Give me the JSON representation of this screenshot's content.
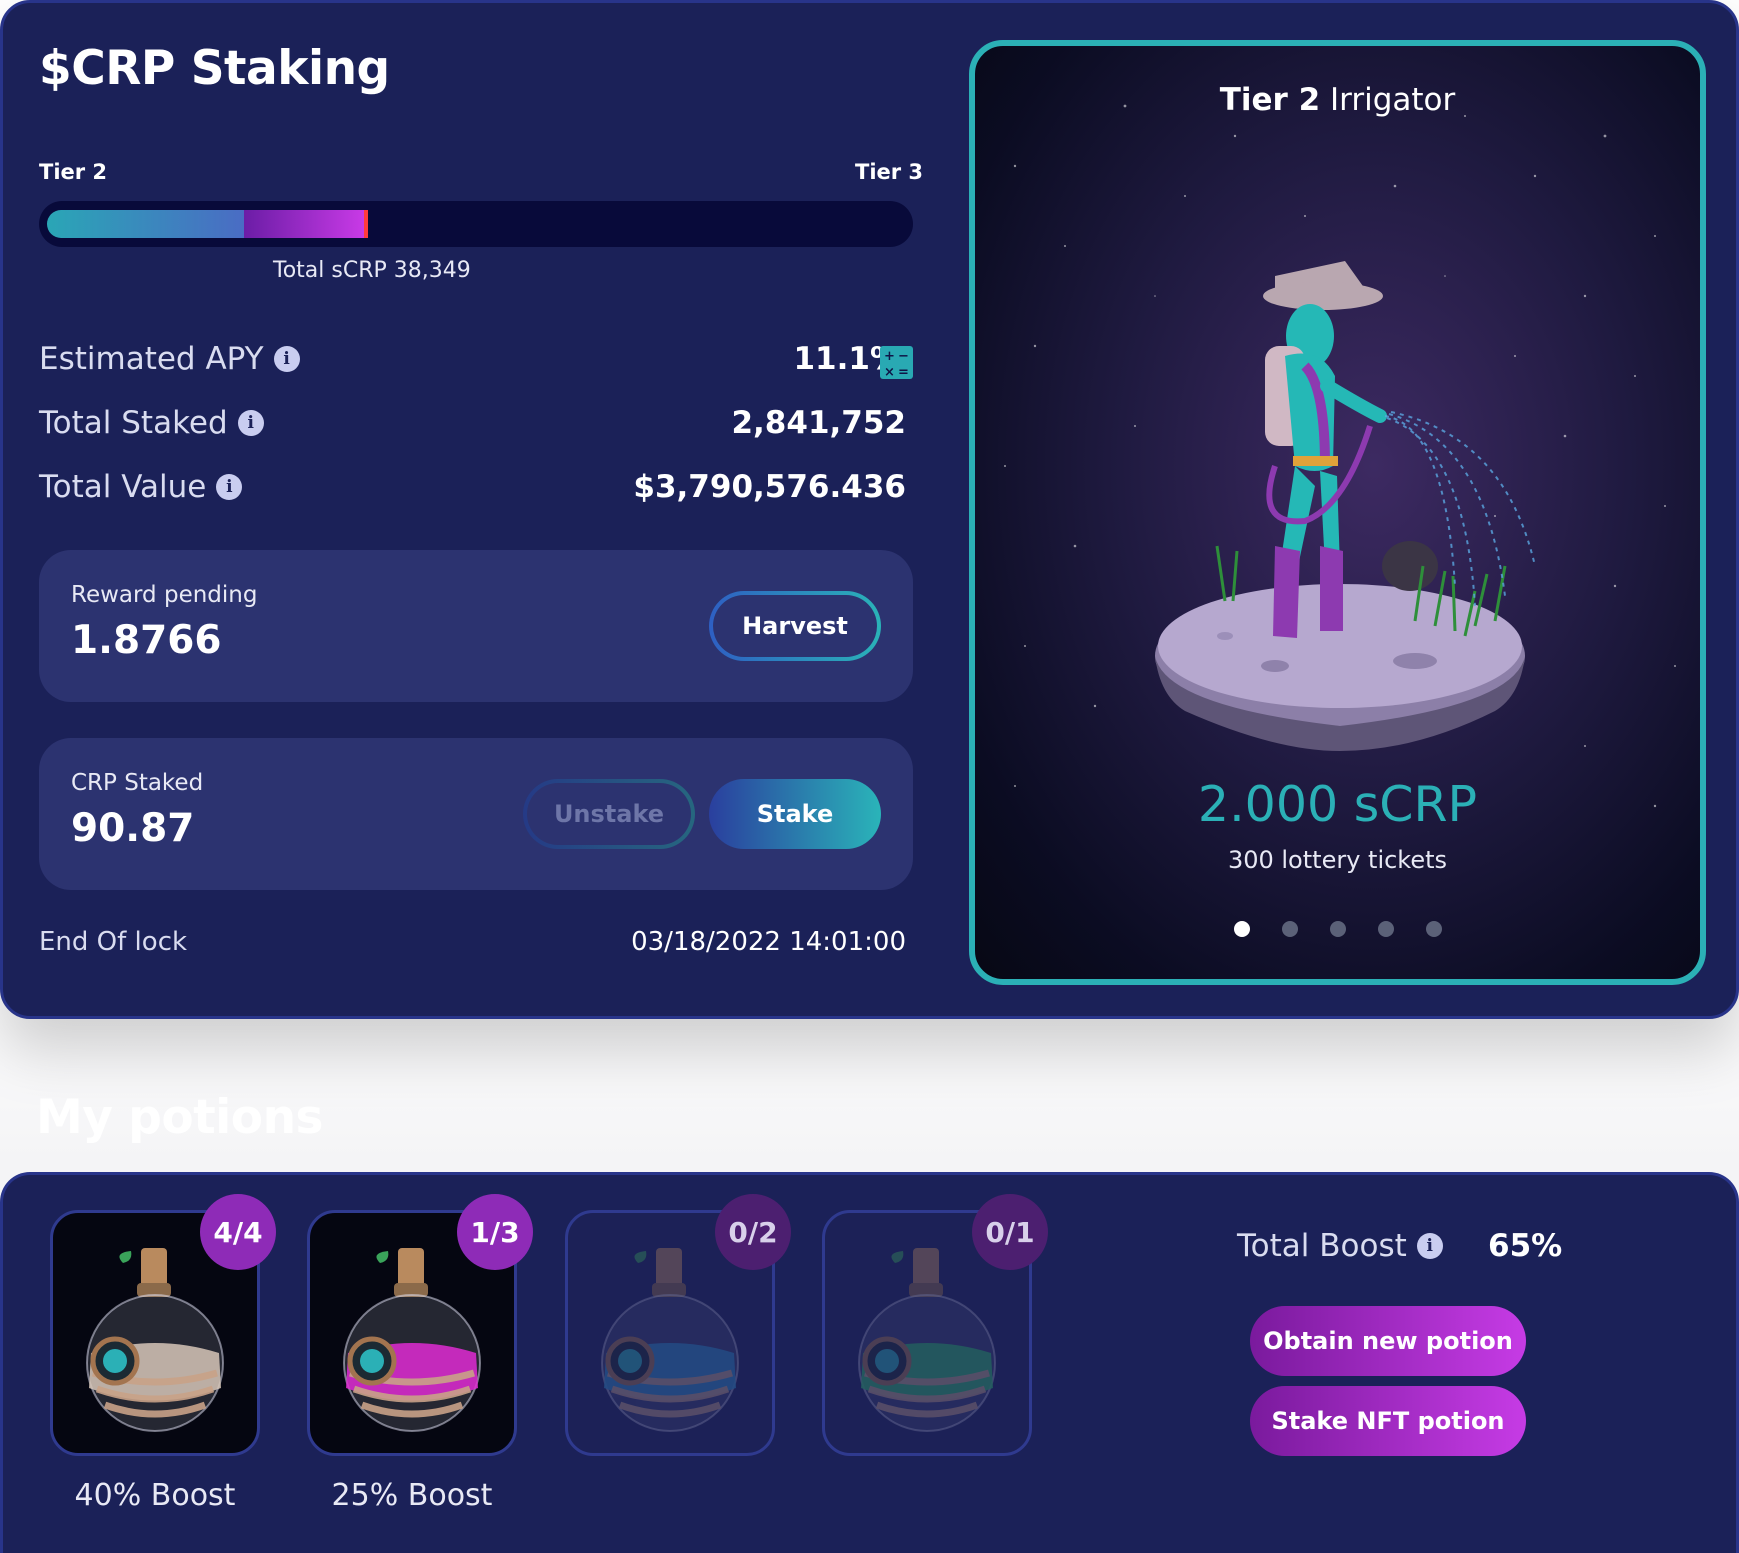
{
  "staking": {
    "title": "$CRP Staking",
    "progress": {
      "tier_left": "Tier 2",
      "tier_right": "Tier 3",
      "fill_primary_fraction": 0.23,
      "fill_secondary_fraction": 0.14,
      "total_label": "Total sCRP 38,349"
    },
    "stats": {
      "apy_label": "Estimated APY",
      "apy_value": "11.1%",
      "staked_label": "Total Staked",
      "staked_value": "2,841,752",
      "value_label": "Total Value",
      "value_value": "$3,790,576.436"
    },
    "reward": {
      "label": "Reward pending",
      "value": "1.8766",
      "harvest_label": "Harvest"
    },
    "staked": {
      "label": "CRP Staked",
      "value": "90.87",
      "unstake_label": "Unstake",
      "stake_label": "Stake"
    },
    "lock": {
      "label": "End Of lock",
      "value": "03/18/2022 14:01:00"
    }
  },
  "showcase": {
    "tier": "Tier 2",
    "name": "Irrigator",
    "amount": "2.000 sCRP",
    "tickets": "300 lottery tickets",
    "dots_total": 5,
    "dots_active": 0,
    "accent": "#2bb0b6"
  },
  "potions": {
    "section_title": "My potions",
    "items": [
      {
        "badge": "4/4",
        "caption": "40% Boost",
        "color": "#d7c7b9"
      },
      {
        "badge": "1/3",
        "caption": "25% Boost",
        "color": "#e02bd4"
      },
      {
        "badge": "0/2",
        "caption": "",
        "color": "#2f9ad6"
      },
      {
        "badge": "0/1",
        "caption": "",
        "color": "#2fcf6b"
      }
    ],
    "total_boost_label": "Total Boost",
    "total_boost_value": "65%",
    "obtain_label": "Obtain new potion",
    "stake_nft_label": "Stake NFT potion"
  }
}
